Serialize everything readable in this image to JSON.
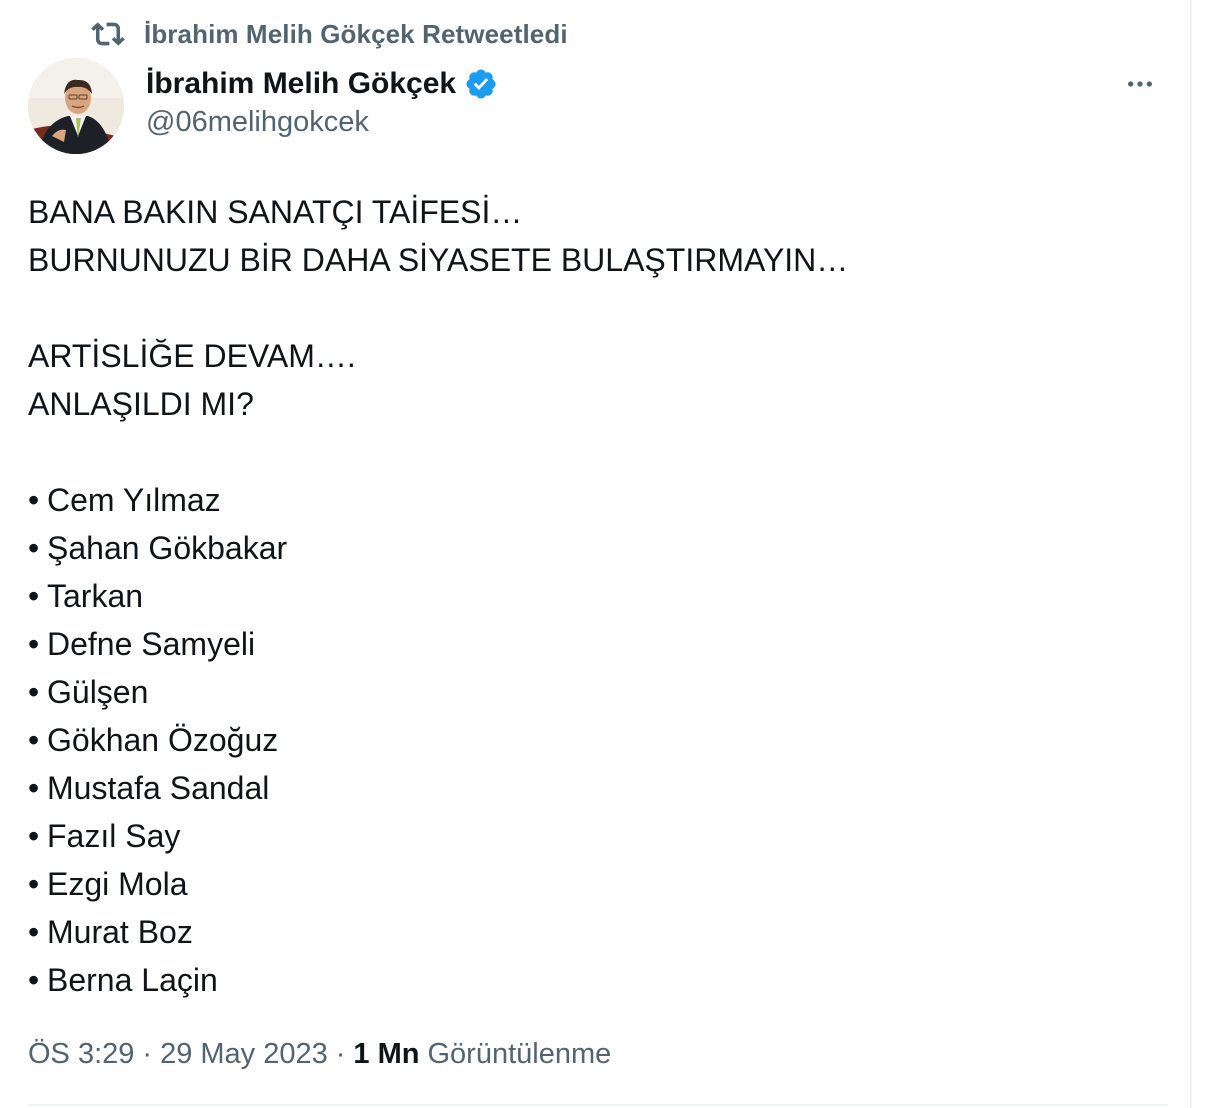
{
  "social_context": {
    "icon": "retweet-icon",
    "text": "İbrahim Melih Gökçek Retweetledi"
  },
  "author": {
    "display_name": "İbrahim Melih Gökçek",
    "handle": "@06melihgokcek",
    "verified_icon": "verified-badge-icon",
    "verified_color": "#1d9bf0"
  },
  "more_icon": "more-options-icon",
  "tweet": {
    "lines": [
      "BANA BAKIN SANATÇI TAİFESİ…",
      "BURNUNUZU BİR DAHA SİYASETE BULAŞTIRMAYIN…",
      "",
      "ARTİSLİĞE DEVAM….",
      "ANLAŞILDI MI?",
      ""
    ],
    "bullet": "•",
    "list": [
      "Cem Yılmaz",
      "Şahan Gökbakar",
      "Tarkan",
      "Defne Samyeli",
      "Gülşen",
      "Gökhan Özoğuz",
      "Mustafa Sandal",
      "Fazıl Say",
      "Ezgi Mola",
      "Murat Boz",
      "Berna Laçin"
    ]
  },
  "meta": {
    "time": "ÖS 3:29",
    "separator": "·",
    "date": "29 May 2023",
    "views_count": "1 Mn",
    "views_label": "Görüntülenme"
  },
  "colors": {
    "text_primary": "#0f1419",
    "text_secondary": "#536471",
    "border": "#eff3f4"
  }
}
